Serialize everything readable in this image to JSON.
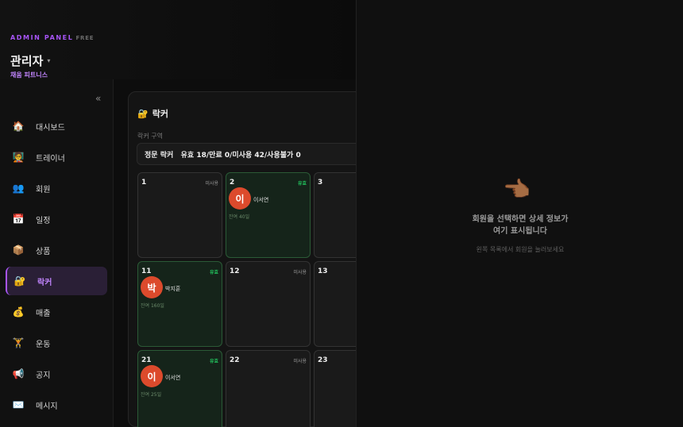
{
  "header": {
    "panel_label": "ADMIN PANEL",
    "plan_badge": "FREE",
    "user_name": "관리자",
    "caret": "▾",
    "gym_name": "채움 피트니스"
  },
  "sidebar": {
    "collapse_icon": "«",
    "items": [
      {
        "icon": "🏠",
        "label": "대시보드"
      },
      {
        "icon": "🧑‍🏫",
        "label": "트레이너"
      },
      {
        "icon": "👥",
        "label": "회원"
      },
      {
        "icon": "📅",
        "label": "일정"
      },
      {
        "icon": "📦",
        "label": "상품"
      },
      {
        "icon": "🔐",
        "label": "락커",
        "active": true
      },
      {
        "icon": "💰",
        "label": "매출"
      },
      {
        "icon": "🏋️",
        "label": "운동"
      },
      {
        "icon": "📢",
        "label": "공지"
      },
      {
        "icon": "✉️",
        "label": "메시지"
      }
    ]
  },
  "locker_page": {
    "title_icon": "🔐",
    "title": "락커",
    "zone_label": "락커 구역",
    "zone_value": "정문 락커   유효 18/만료 0/미사용 42/사용불가 0",
    "lockers": [
      {
        "num": "1",
        "status": "미사용",
        "state": "unused"
      },
      {
        "num": "2",
        "status": "유효",
        "state": "valid",
        "initial": "이",
        "member": "이서연",
        "remain": "잔여 40일"
      },
      {
        "num": "3",
        "status": "",
        "state": "unused"
      },
      {
        "num": "11",
        "status": "유효",
        "state": "valid",
        "initial": "박",
        "member": "박지훈",
        "remain": "잔여 160일"
      },
      {
        "num": "12",
        "status": "미사용",
        "state": "unused"
      },
      {
        "num": "13",
        "status": "",
        "state": "unused"
      },
      {
        "num": "21",
        "status": "유효",
        "state": "valid",
        "initial": "이",
        "member": "이서연",
        "remain": "잔여 25일"
      },
      {
        "num": "22",
        "status": "미사용",
        "state": "unused"
      },
      {
        "num": "23",
        "status": "",
        "state": "unused"
      }
    ]
  },
  "detail": {
    "icon": "👈🏾",
    "message_line1": "회원을 선택하면 상세 정보가",
    "message_line2": "여기 표시됩니다",
    "hint": "왼쪽 목록에서 회원을 눌러보세요"
  }
}
